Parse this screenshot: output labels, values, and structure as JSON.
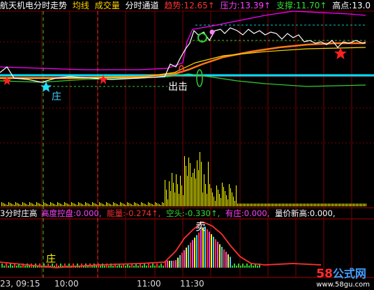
{
  "top_bar": {
    "stock_name": "航天机电",
    "title": "分时走势",
    "avg_line": "均线",
    "volume": "成交量",
    "channel": "分时通道",
    "trend_label": "趋势:",
    "trend_value": "12.65↑",
    "pressure_label": "压力:",
    "pressure_value": "13.39↑",
    "support_label": "支撑:",
    "support_value": "11.70↑",
    "high_label": "高点:",
    "high_value": "13.0"
  },
  "mid_bar": {
    "name": "3分时庄高",
    "control_label": "高度控盘:",
    "control_value": "0.000,",
    "energy_label": "能量:",
    "energy_value": "-0.274↑,",
    "short_label": "空头:",
    "short_value": "-0.330↑,",
    "dealer_label": "有庄:",
    "dealer_value": "0.000,",
    "new_high_label": "量价新高:",
    "new_high_value": "0.000,"
  },
  "time_axis": {
    "date_time": "23, 09:15",
    "t1": "10:00",
    "t2": "11:00",
    "t3": "11:30"
  },
  "annotations": {
    "zhuang_top": "庄",
    "chuji": "出击",
    "sell": "卖",
    "zhuang_bottom": "庄"
  },
  "watermark": {
    "number": "58",
    "text": "公式网",
    "url": "www.58gu.com"
  },
  "colors": {
    "grid": "#7a0000",
    "price": "#ffffff",
    "avg": "#ffd400",
    "trend": "#ff7a1a",
    "support_line": "#33cc33",
    "pressure_line": "#ff00ff",
    "base_line": "#00e0ff",
    "volume": "#ffff00",
    "star_red": "#ff2020",
    "star_cyan": "#20e0ff"
  }
}
